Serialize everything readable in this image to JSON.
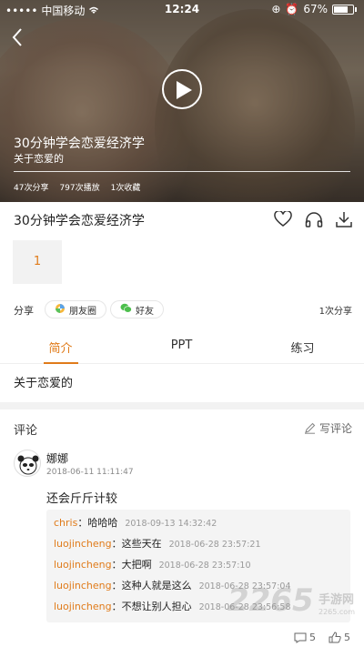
{
  "status": {
    "carrier": "中国移动",
    "time": "12:24",
    "battery": "67%"
  },
  "hero": {
    "title": "30分钟学会恋爱经济学",
    "subtitle": "关于恋爱的",
    "stats": [
      "47次分享",
      "797次播放",
      "1次收藏"
    ]
  },
  "detail": {
    "title": "30分钟学会恋爱经济学",
    "episode": "1"
  },
  "share": {
    "label": "分享",
    "moments": "朋友圈",
    "friends": "好友",
    "count": "1次分享"
  },
  "tabs": [
    "简介",
    "PPT",
    "练习"
  ],
  "intro": "关于恋爱的",
  "comments": {
    "title": "评论",
    "write": "写评论",
    "item": {
      "user": "娜娜",
      "time": "2018-06-11 11:11:47",
      "text": "还会斤斤计较",
      "replies": [
        {
          "who": "chris",
          "msg": "：哈哈哈",
          "when": "2018-09-13 14:32:42"
        },
        {
          "who": "luojincheng",
          "msg": "：这些天在",
          "when": "2018-06-28 23:57:21"
        },
        {
          "who": "luojincheng",
          "msg": "：大把啊",
          "when": "2018-06-28 23:57:10"
        },
        {
          "who": "luojincheng",
          "msg": "：这种人就是这么",
          "when": "2018-06-28 23:57:04"
        },
        {
          "who": "luojincheng",
          "msg": "：不想让别人担心",
          "when": "2018-06-28 23:56:58"
        }
      ],
      "reply_count": "5",
      "like_count": "5"
    }
  },
  "watermark": {
    "brand": "2265",
    "name": "手游网",
    "url": "2265.com"
  },
  "colors": {
    "accent": "#e07b1a"
  }
}
